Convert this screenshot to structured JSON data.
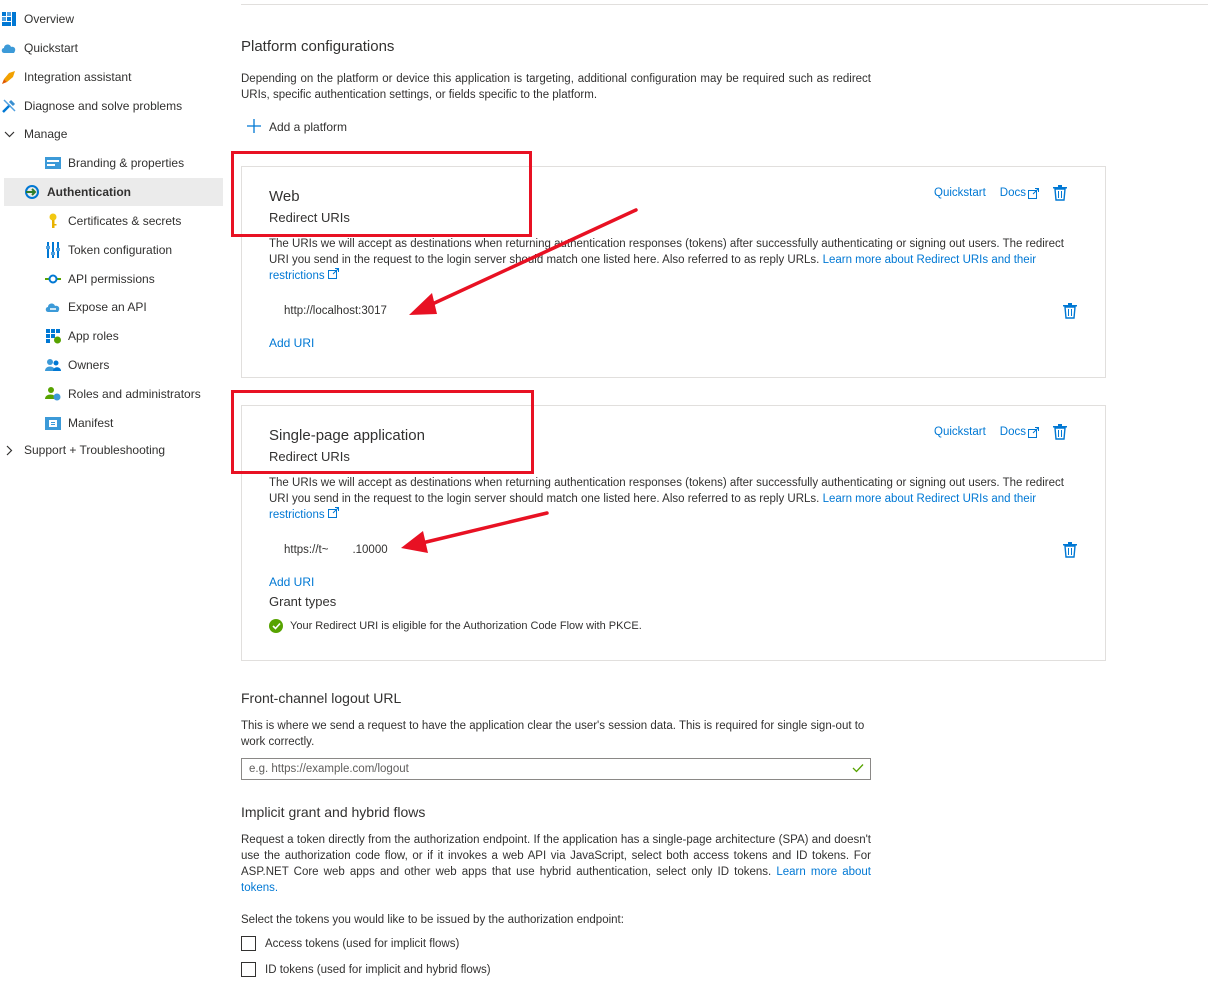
{
  "sidebar": {
    "items": [
      {
        "label": "Overview",
        "icon": "overview-icon"
      },
      {
        "label": "Quickstart",
        "icon": "quickstart-cloud-icon"
      },
      {
        "label": "Integration assistant",
        "icon": "rocket-icon"
      },
      {
        "label": "Diagnose and solve problems",
        "icon": "wrench-icon"
      },
      {
        "label": "Manage",
        "icon": "chevron-down-icon"
      },
      {
        "label": "Branding & properties",
        "icon": "branding-icon"
      },
      {
        "label": "Authentication",
        "icon": "authentication-icon"
      },
      {
        "label": "Certificates & secrets",
        "icon": "key-icon"
      },
      {
        "label": "Token configuration",
        "icon": "token-config-icon"
      },
      {
        "label": "API permissions",
        "icon": "api-permissions-icon"
      },
      {
        "label": "Expose an API",
        "icon": "cloud-api-icon"
      },
      {
        "label": "App roles",
        "icon": "app-roles-icon"
      },
      {
        "label": "Owners",
        "icon": "owners-icon"
      },
      {
        "label": "Roles and administrators",
        "icon": "roles-admins-icon"
      },
      {
        "label": "Manifest",
        "icon": "manifest-icon"
      },
      {
        "label": "Support + Troubleshooting",
        "icon": "chevron-right-icon"
      }
    ],
    "selected": "Authentication"
  },
  "platform": {
    "title": "Platform configurations",
    "description": "Depending on the platform or device this application is targeting, additional configuration may be required such as redirect URIs, specific authentication settings, or fields specific to the platform.",
    "add_label": "Add a platform"
  },
  "web_card": {
    "title": "Web",
    "subtitle": "Redirect URIs",
    "quickstart": "Quickstart",
    "docs": "Docs",
    "desc_text": "The URIs we will accept as destinations when returning authentication responses (tokens) after successfully authenticating or signing out users. The redirect URI you send in the request to the login server should match one listed here. Also referred to as reply URLs.",
    "learn_more": "Learn more about Redirect URIs and their restrictions",
    "uri": "http://localhost:3017",
    "add_uri": "Add URI"
  },
  "spa_card": {
    "title": "Single-page application",
    "subtitle": "Redirect URIs",
    "quickstart": "Quickstart",
    "docs": "Docs",
    "desc_text": "The URIs we will accept as destinations when returning authentication responses (tokens) after successfully authenticating or signing out users. The redirect URI you send in the request to the login server should match one listed here. Also referred to as reply URLs.",
    "learn_more": "Learn more about Redirect URIs and their restrictions",
    "uri_start": "https://t~",
    "uri_end": ".10000",
    "add_uri": "Add URI",
    "grant_title": "Grant types",
    "grant_msg": "Your Redirect URI is eligible for the Authorization Code Flow with PKCE."
  },
  "logout": {
    "title": "Front-channel logout URL",
    "description": "This is where we send a request to have the application clear the user's session data. This is required for single sign-out to work correctly.",
    "placeholder": "e.g. https://example.com/logout"
  },
  "implicit": {
    "title": "Implicit grant and hybrid flows",
    "description": "Request a token directly from the authorization endpoint. If the application has a single-page architecture (SPA) and doesn't use the authorization code flow, or if it invokes a web API via JavaScript, select both access tokens and ID tokens. For ASP.NET Core web apps and other web apps that use hybrid authentication, select only ID tokens.",
    "learn_more": "Learn more about tokens.",
    "select_prompt": "Select the tokens you would like to be issued by the authorization endpoint:",
    "access_tokens": "Access tokens (used for implicit flows)",
    "id_tokens": "ID tokens (used for implicit and hybrid flows)",
    "access_checked": false,
    "id_checked": false
  },
  "colors": {
    "accent": "#0078d4",
    "annotation": "#e81123",
    "success": "#57a300"
  }
}
